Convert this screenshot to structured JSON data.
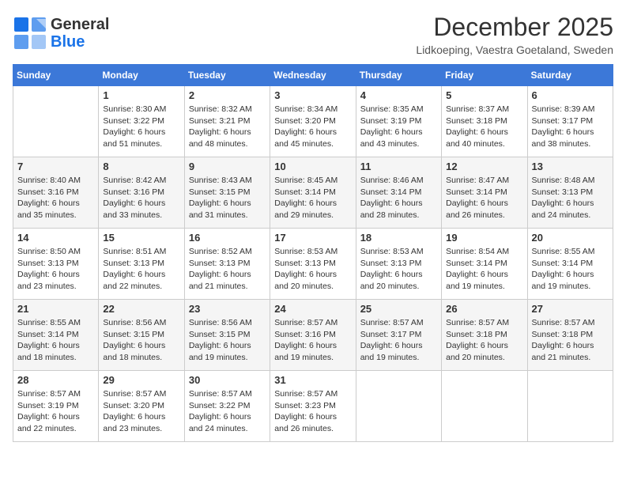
{
  "logo": {
    "line1": "General",
    "line2": "Blue"
  },
  "header": {
    "month": "December 2025",
    "location": "Lidkoeping, Vaestra Goetaland, Sweden"
  },
  "weekdays": [
    "Sunday",
    "Monday",
    "Tuesday",
    "Wednesday",
    "Thursday",
    "Friday",
    "Saturday"
  ],
  "weeks": [
    [
      {
        "day": "",
        "sunrise": "",
        "sunset": "",
        "daylight": ""
      },
      {
        "day": "1",
        "sunrise": "Sunrise: 8:30 AM",
        "sunset": "Sunset: 3:22 PM",
        "daylight": "Daylight: 6 hours and 51 minutes."
      },
      {
        "day": "2",
        "sunrise": "Sunrise: 8:32 AM",
        "sunset": "Sunset: 3:21 PM",
        "daylight": "Daylight: 6 hours and 48 minutes."
      },
      {
        "day": "3",
        "sunrise": "Sunrise: 8:34 AM",
        "sunset": "Sunset: 3:20 PM",
        "daylight": "Daylight: 6 hours and 45 minutes."
      },
      {
        "day": "4",
        "sunrise": "Sunrise: 8:35 AM",
        "sunset": "Sunset: 3:19 PM",
        "daylight": "Daylight: 6 hours and 43 minutes."
      },
      {
        "day": "5",
        "sunrise": "Sunrise: 8:37 AM",
        "sunset": "Sunset: 3:18 PM",
        "daylight": "Daylight: 6 hours and 40 minutes."
      },
      {
        "day": "6",
        "sunrise": "Sunrise: 8:39 AM",
        "sunset": "Sunset: 3:17 PM",
        "daylight": "Daylight: 6 hours and 38 minutes."
      }
    ],
    [
      {
        "day": "7",
        "sunrise": "Sunrise: 8:40 AM",
        "sunset": "Sunset: 3:16 PM",
        "daylight": "Daylight: 6 hours and 35 minutes."
      },
      {
        "day": "8",
        "sunrise": "Sunrise: 8:42 AM",
        "sunset": "Sunset: 3:16 PM",
        "daylight": "Daylight: 6 hours and 33 minutes."
      },
      {
        "day": "9",
        "sunrise": "Sunrise: 8:43 AM",
        "sunset": "Sunset: 3:15 PM",
        "daylight": "Daylight: 6 hours and 31 minutes."
      },
      {
        "day": "10",
        "sunrise": "Sunrise: 8:45 AM",
        "sunset": "Sunset: 3:14 PM",
        "daylight": "Daylight: 6 hours and 29 minutes."
      },
      {
        "day": "11",
        "sunrise": "Sunrise: 8:46 AM",
        "sunset": "Sunset: 3:14 PM",
        "daylight": "Daylight: 6 hours and 28 minutes."
      },
      {
        "day": "12",
        "sunrise": "Sunrise: 8:47 AM",
        "sunset": "Sunset: 3:14 PM",
        "daylight": "Daylight: 6 hours and 26 minutes."
      },
      {
        "day": "13",
        "sunrise": "Sunrise: 8:48 AM",
        "sunset": "Sunset: 3:13 PM",
        "daylight": "Daylight: 6 hours and 24 minutes."
      }
    ],
    [
      {
        "day": "14",
        "sunrise": "Sunrise: 8:50 AM",
        "sunset": "Sunset: 3:13 PM",
        "daylight": "Daylight: 6 hours and 23 minutes."
      },
      {
        "day": "15",
        "sunrise": "Sunrise: 8:51 AM",
        "sunset": "Sunset: 3:13 PM",
        "daylight": "Daylight: 6 hours and 22 minutes."
      },
      {
        "day": "16",
        "sunrise": "Sunrise: 8:52 AM",
        "sunset": "Sunset: 3:13 PM",
        "daylight": "Daylight: 6 hours and 21 minutes."
      },
      {
        "day": "17",
        "sunrise": "Sunrise: 8:53 AM",
        "sunset": "Sunset: 3:13 PM",
        "daylight": "Daylight: 6 hours and 20 minutes."
      },
      {
        "day": "18",
        "sunrise": "Sunrise: 8:53 AM",
        "sunset": "Sunset: 3:13 PM",
        "daylight": "Daylight: 6 hours and 20 minutes."
      },
      {
        "day": "19",
        "sunrise": "Sunrise: 8:54 AM",
        "sunset": "Sunset: 3:14 PM",
        "daylight": "Daylight: 6 hours and 19 minutes."
      },
      {
        "day": "20",
        "sunrise": "Sunrise: 8:55 AM",
        "sunset": "Sunset: 3:14 PM",
        "daylight": "Daylight: 6 hours and 19 minutes."
      }
    ],
    [
      {
        "day": "21",
        "sunrise": "Sunrise: 8:55 AM",
        "sunset": "Sunset: 3:14 PM",
        "daylight": "Daylight: 6 hours and 18 minutes."
      },
      {
        "day": "22",
        "sunrise": "Sunrise: 8:56 AM",
        "sunset": "Sunset: 3:15 PM",
        "daylight": "Daylight: 6 hours and 18 minutes."
      },
      {
        "day": "23",
        "sunrise": "Sunrise: 8:56 AM",
        "sunset": "Sunset: 3:15 PM",
        "daylight": "Daylight: 6 hours and 19 minutes."
      },
      {
        "day": "24",
        "sunrise": "Sunrise: 8:57 AM",
        "sunset": "Sunset: 3:16 PM",
        "daylight": "Daylight: 6 hours and 19 minutes."
      },
      {
        "day": "25",
        "sunrise": "Sunrise: 8:57 AM",
        "sunset": "Sunset: 3:17 PM",
        "daylight": "Daylight: 6 hours and 19 minutes."
      },
      {
        "day": "26",
        "sunrise": "Sunrise: 8:57 AM",
        "sunset": "Sunset: 3:18 PM",
        "daylight": "Daylight: 6 hours and 20 minutes."
      },
      {
        "day": "27",
        "sunrise": "Sunrise: 8:57 AM",
        "sunset": "Sunset: 3:18 PM",
        "daylight": "Daylight: 6 hours and 21 minutes."
      }
    ],
    [
      {
        "day": "28",
        "sunrise": "Sunrise: 8:57 AM",
        "sunset": "Sunset: 3:19 PM",
        "daylight": "Daylight: 6 hours and 22 minutes."
      },
      {
        "day": "29",
        "sunrise": "Sunrise: 8:57 AM",
        "sunset": "Sunset: 3:20 PM",
        "daylight": "Daylight: 6 hours and 23 minutes."
      },
      {
        "day": "30",
        "sunrise": "Sunrise: 8:57 AM",
        "sunset": "Sunset: 3:22 PM",
        "daylight": "Daylight: 6 hours and 24 minutes."
      },
      {
        "day": "31",
        "sunrise": "Sunrise: 8:57 AM",
        "sunset": "Sunset: 3:23 PM",
        "daylight": "Daylight: 6 hours and 26 minutes."
      },
      {
        "day": "",
        "sunrise": "",
        "sunset": "",
        "daylight": ""
      },
      {
        "day": "",
        "sunrise": "",
        "sunset": "",
        "daylight": ""
      },
      {
        "day": "",
        "sunrise": "",
        "sunset": "",
        "daylight": ""
      }
    ]
  ]
}
